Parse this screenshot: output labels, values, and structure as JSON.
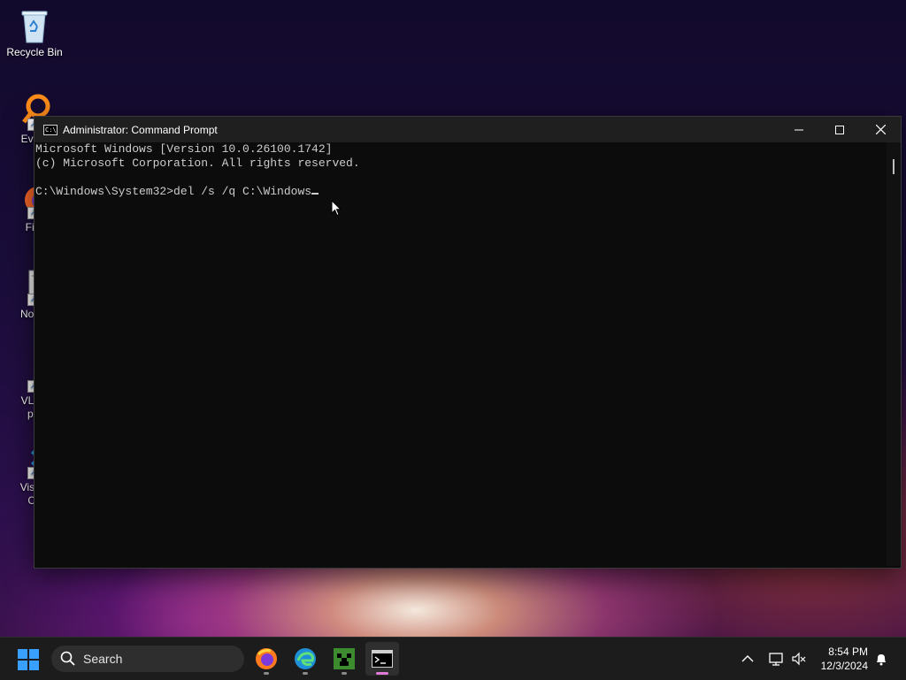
{
  "desktop": {
    "icons": [
      {
        "label": "Recycle Bin"
      },
      {
        "label": "Every"
      },
      {
        "label": "Fire"
      },
      {
        "label": "Notep"
      },
      {
        "label": "VLC r"
      },
      {
        "label": "pla"
      },
      {
        "label": "Visual"
      },
      {
        "label": "Co"
      }
    ]
  },
  "window": {
    "title": "Administrator: Command Prompt",
    "icon_text": "C:\\",
    "controls": {
      "minimize": "minimize-icon",
      "maximize": "maximize-icon",
      "close": "close-icon"
    }
  },
  "console": {
    "lines": [
      "Microsoft Windows [Version 10.0.26100.1742]",
      "(c) Microsoft Corporation. All rights reserved.",
      "",
      "C:\\Windows\\System32>del /s /q C:\\Windows"
    ]
  },
  "taskbar": {
    "search_placeholder": "Search",
    "apps": [
      "firefox-icon",
      "edge-icon",
      "minecraft-icon",
      "command-prompt-icon"
    ],
    "clock": {
      "time": "8:54 PM",
      "date": "12/3/2024"
    }
  },
  "colors": {
    "console_bg": "#0c0c0c",
    "console_text": "#cccccc",
    "titlebar": "#1f1f1f",
    "taskbar": "#1c1c1c",
    "active_indicator": "#e07ad8"
  }
}
